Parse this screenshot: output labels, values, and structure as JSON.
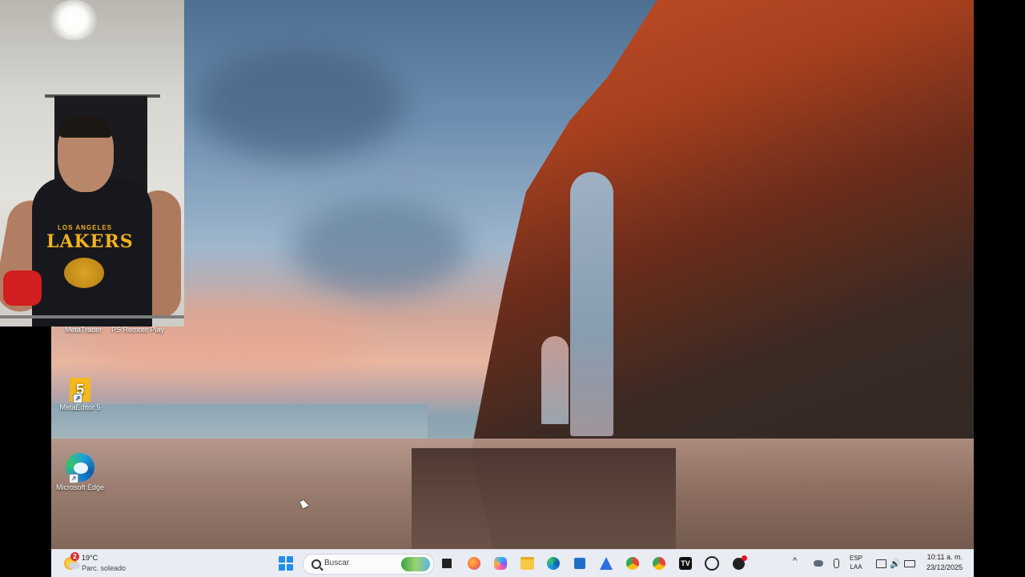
{
  "desktop": {
    "icons": [
      {
        "label": "MetaTrader"
      },
      {
        "label": "PS Remote Play"
      },
      {
        "label": "MetaEditor 5"
      },
      {
        "label": "Microsoft Edge"
      }
    ]
  },
  "webcam": {
    "jersey_top": "LOS ANGELES",
    "jersey_main": "LAKERS"
  },
  "taskbar": {
    "weather": {
      "badge": "2",
      "temp": "19°C",
      "desc": "Parc. soleado"
    },
    "search": {
      "placeholder": "Buscar"
    },
    "pinned": [
      {
        "name": "task-view"
      },
      {
        "name": "firefox"
      },
      {
        "name": "copilot"
      },
      {
        "name": "file-explorer"
      },
      {
        "name": "edge"
      },
      {
        "name": "microsoft-store"
      },
      {
        "name": "app-a"
      },
      {
        "name": "chrome-1"
      },
      {
        "name": "chrome-2"
      },
      {
        "name": "tradingview"
      },
      {
        "name": "chatgpt"
      },
      {
        "name": "app-b"
      }
    ],
    "tray": {
      "lang_top": "ESP",
      "lang_bottom": "LAA",
      "time": "10:11 a. m.",
      "date": "23/12/2025"
    }
  }
}
